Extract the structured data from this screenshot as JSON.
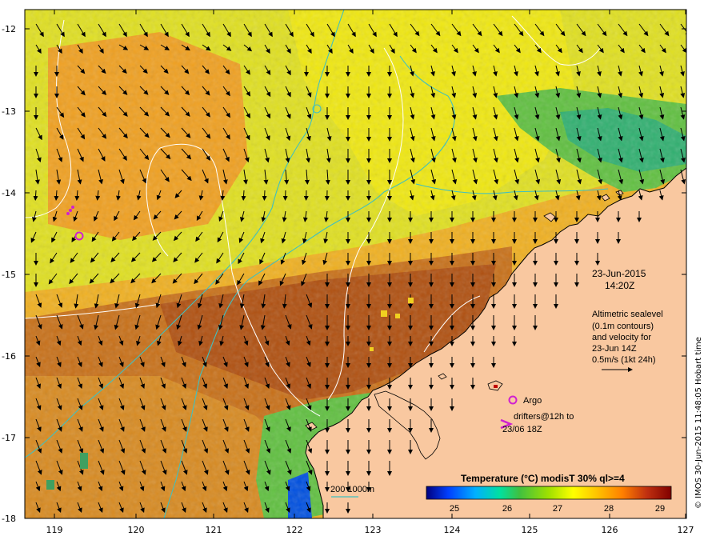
{
  "map": {
    "date_line": "23-Jun-2015",
    "time_line": "14:20Z",
    "info_lines": [
      "Altimetric sealevel",
      "(0.1m contours)",
      "and velocity for",
      "23-Jun 14Z",
      "0.5m/s (1kt 24h)"
    ],
    "argo_label": "Argo",
    "drifters_lines": [
      "drifters@12h to",
      "23/06 18Z"
    ],
    "bathy_label": "200  1000m",
    "side_text": "© IMOS 30-Jun-2015 11:48:05 Hobart time",
    "lon_ticks": [
      "119",
      "120",
      "121",
      "122",
      "123",
      "124",
      "125",
      "126",
      "127"
    ],
    "lat_ticks": [
      "-12",
      "-13",
      "-14",
      "-15",
      "-16",
      "-17",
      "-18"
    ],
    "colorbar": {
      "title": "Temperature (°C) modisT 30% ql>=4",
      "ticks": [
        "25",
        "26",
        "27",
        "28",
        "29"
      ],
      "colors": [
        "#000080",
        "#0040ff",
        "#00b0ff",
        "#00e0a0",
        "#40c040",
        "#a0e000",
        "#ffff00",
        "#ffc000",
        "#ff8000",
        "#d04000",
        "#a02000",
        "#800000"
      ]
    },
    "colors": {
      "land": "#f9c8a0",
      "argo": "#d020d0",
      "contour": "#ffffff",
      "bathy": "#40c0c0",
      "arrow": "#000000"
    }
  }
}
